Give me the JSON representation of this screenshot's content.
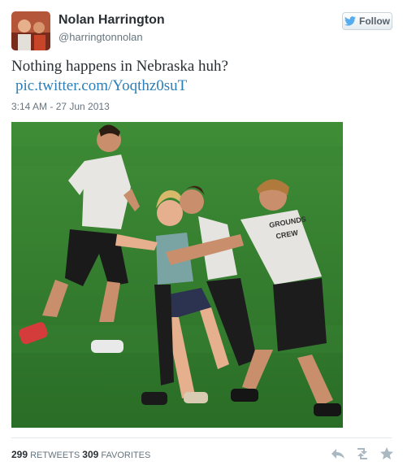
{
  "user": {
    "name": "Nolan Harrington",
    "handle": "@harringtonnolan",
    "avatar_icon": "user-avatar"
  },
  "follow": {
    "label": "Follow",
    "icon": "twitter-bird-icon"
  },
  "tweet": {
    "text": "Nothing happens in Nebraska huh?",
    "link": "pic.twitter.com/Yoqthz0suT",
    "timestamp": "3:14 AM - 27 Jun 2013"
  },
  "photo": {
    "description_icon": "tweet-photo",
    "shirt_text_line1": "GROUNDS",
    "shirt_text_line2": "CREW"
  },
  "stats": {
    "retweets_count": "299",
    "retweets_label": "RETWEETS",
    "favorites_count": "309",
    "favorites_label": "FAVORITES"
  },
  "actions": [
    "reply-icon",
    "retweet-icon",
    "favorite-icon"
  ],
  "colors": {
    "link": "#2a7fb8",
    "muted": "#66757f",
    "grass": "#2f7a2c"
  }
}
